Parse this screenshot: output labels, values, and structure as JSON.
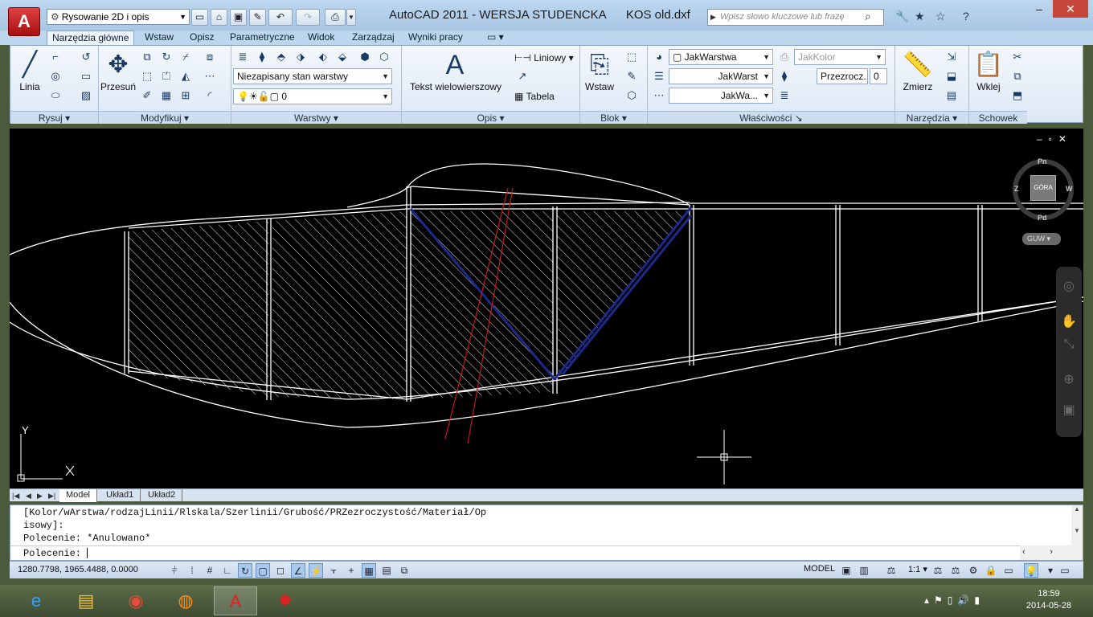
{
  "titlebar": {
    "app_icon": "autocad-logo",
    "workspace": "Rysowanie 2D i opis",
    "title": "AutoCAD 2011 - WERSJA STUDENCKA      KOS old.dxf",
    "search_placeholder": "Wpisz słowo kluczowe lub frazę"
  },
  "ribbon": {
    "tabs": [
      "Narzędzia główne",
      "Wstaw",
      "Opisz",
      "Parametryczne",
      "Widok",
      "Zarządzaj",
      "Wyniki pracy"
    ],
    "active_tab": "Narzędzia główne",
    "panels": {
      "rysuj": {
        "label": "Rysuj",
        "line": "Linia"
      },
      "modyfikuj": {
        "label": "Modyfikuj",
        "move": "Przesuń"
      },
      "warstwy": {
        "label": "Warstwy",
        "layer_state": "Niezapisany stan warstwy",
        "current_layer": "0"
      },
      "opis": {
        "label": "Opis",
        "mtext": "Tekst wielowierszowy",
        "linear": "Liniowy",
        "table": "Tabela"
      },
      "blok": {
        "label": "Blok",
        "insert": "Wstaw"
      },
      "wlasciwosci": {
        "label": "Właściwości",
        "color": "JakWarstwa",
        "color2": "JakKolor",
        "linetype": "JakWarst",
        "lineweight": "JakWa...",
        "transparency_label": "Przezrocz...",
        "transparency_value": "0"
      },
      "narzedzia": {
        "label": "Narzędzia",
        "measure": "Zmierz"
      },
      "schowek": {
        "label": "Schowek",
        "paste": "Wklej"
      }
    }
  },
  "viewport": {
    "viewcube": {
      "top": "GÓRA",
      "north": "Pn",
      "south": "Pd",
      "west": "Z",
      "east": "W"
    },
    "ucs": "GUW",
    "ucs_y": "Y"
  },
  "layout_tabs": [
    "Model",
    "Układ1",
    "Układ2"
  ],
  "command": {
    "history": [
      "[Kolor/wArstwa/rodzajLinii/Rlskala/Szerlinii/Grubość/PRZezroczystość/Materiał/Op",
      "isowy]:",
      "Polecenie: *Anulowano*"
    ],
    "prompt": "Polecenie:"
  },
  "status": {
    "coordinates": "1280.7798, 1965.4488, 0.0000",
    "model": "MODEL",
    "scale": "1:1"
  },
  "taskbar": {
    "apps": [
      "internet-explorer",
      "file-explorer",
      "chrome",
      "firefox",
      "autocad",
      "paint-splash"
    ],
    "time": "18:59",
    "date": "2014-05-28"
  },
  "colors": {
    "drawing_bg": "#000000",
    "outline": "#ffffff",
    "blue_lines": "#1e2a8a",
    "red_lines": "#c0191a",
    "ribbon_bg": "#dde8f5"
  }
}
